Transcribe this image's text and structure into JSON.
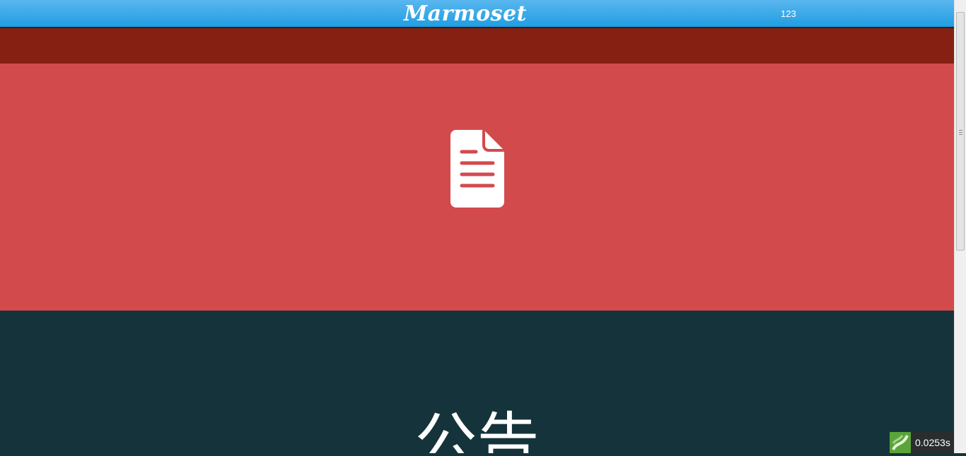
{
  "header": {
    "brand": "Marmoset",
    "user_number": "123",
    "bar_color": "#1f9ee3"
  },
  "hero": {
    "icon": "document-icon",
    "band_color": "#862012",
    "background_color": "#d34a4c"
  },
  "section": {
    "heading": "公告",
    "background_color": "#15333a"
  },
  "debug_timer": {
    "icon": "logo-icon",
    "value": "0.0253s"
  }
}
